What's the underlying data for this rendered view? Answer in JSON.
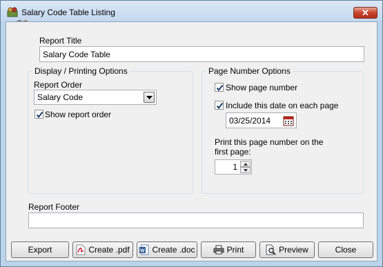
{
  "window": {
    "title": "Salary Code Table Listing",
    "close_glyph": "✕"
  },
  "report_title": {
    "label": "Report Title",
    "value": "Salary Code Table"
  },
  "display_options": {
    "legend": "Display / Printing Options",
    "order_label": "Report Order",
    "order_value": "Salary Code",
    "show_order_label": "Show report order",
    "show_order_checked": true
  },
  "page_number_options": {
    "legend": "Page Number Options",
    "show_page_number_label": "Show page number",
    "show_page_number_checked": true,
    "include_date_label": "Include this date on each page",
    "include_date_checked": true,
    "date_value": "03/25/2014",
    "first_page_label_line1": "Print this page number on the",
    "first_page_label_line2": "first page:",
    "first_page_value": "1"
  },
  "report_footer": {
    "label": "Report Footer",
    "value": ""
  },
  "buttons": {
    "export": "Export",
    "create_pdf": "Create .pdf",
    "create_doc": "Create .doc",
    "print": "Print",
    "preview": "Preview",
    "close": "Close"
  },
  "icons": {
    "app": "app-icon",
    "clipboard": "clipboard-icon",
    "calendar": "calendar-icon",
    "pdf": "pdf-icon",
    "word": "word-doc-icon",
    "printer": "printer-icon",
    "preview": "preview-magnifier-icon"
  }
}
